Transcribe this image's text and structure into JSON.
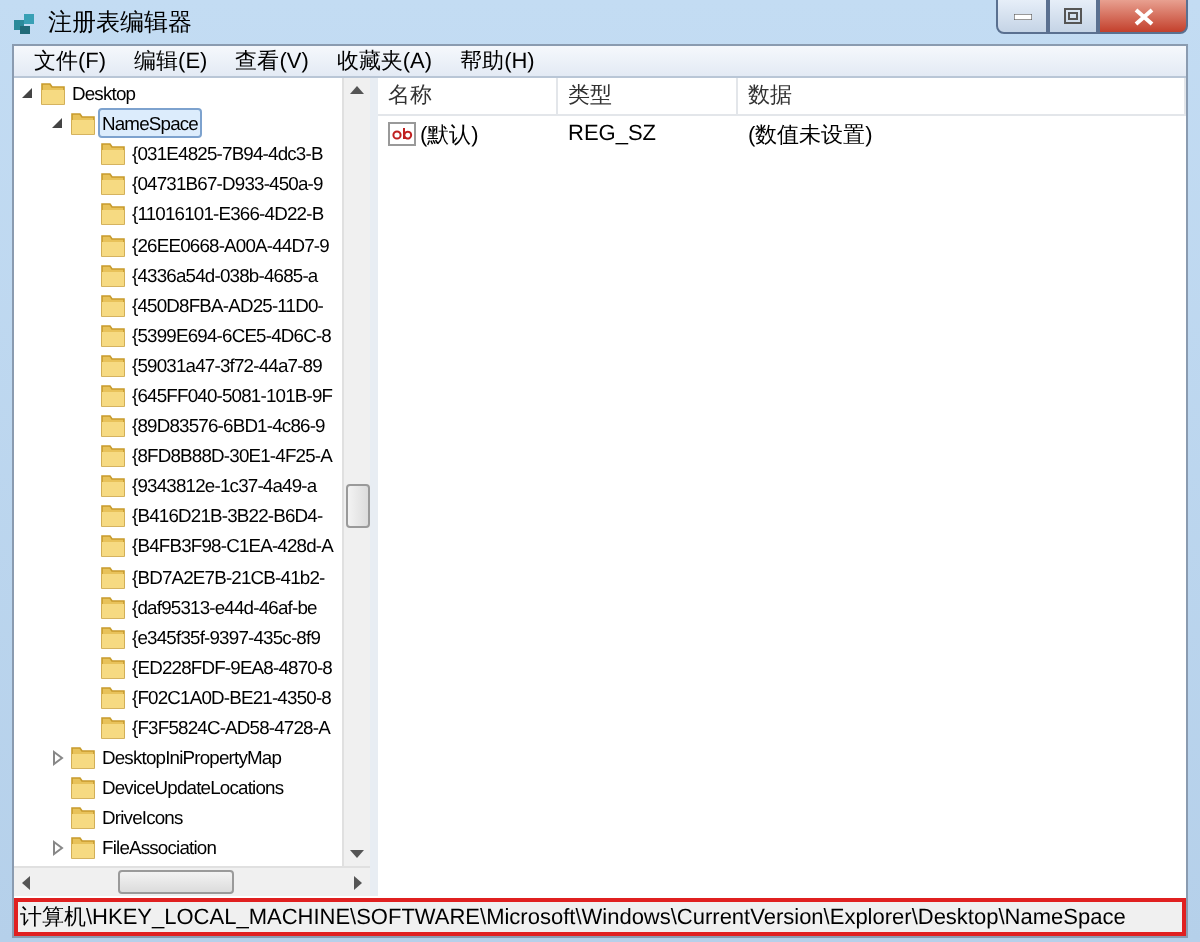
{
  "window": {
    "title": "注册表编辑器"
  },
  "menu": [
    "文件(F)",
    "编辑(E)",
    "查看(V)",
    "收藏夹(A)",
    "帮助(H)"
  ],
  "tree": [
    {
      "label": "Desktop",
      "expanded": true,
      "selected": false,
      "children": [
        {
          "label": "NameSpace",
          "expanded": true,
          "selected": true,
          "children": [
            {
              "label": "{031E4825-7B94-4dc3-B",
              "selected": false
            },
            {
              "label": "{04731B67-D933-450a-9",
              "selected": false
            },
            {
              "label": "{11016101-E366-4D22-B",
              "selected": false
            },
            {
              "label": "{26EE0668-A00A-44D7-9",
              "selected": false
            },
            {
              "label": "{4336a54d-038b-4685-a",
              "selected": false
            },
            {
              "label": "{450D8FBA-AD25-11D0-",
              "selected": false
            },
            {
              "label": "{5399E694-6CE5-4D6C-8",
              "selected": false
            },
            {
              "label": "{59031a47-3f72-44a7-89",
              "selected": false
            },
            {
              "label": "{645FF040-5081-101B-9F",
              "selected": false
            },
            {
              "label": "{89D83576-6BD1-4c86-9",
              "selected": false
            },
            {
              "label": "{8FD8B88D-30E1-4F25-A",
              "selected": false
            },
            {
              "label": "{9343812e-1c37-4a49-a",
              "selected": false
            },
            {
              "label": "{B416D21B-3B22-B6D4-",
              "selected": false
            },
            {
              "label": "{B4FB3F98-C1EA-428d-A",
              "selected": false
            },
            {
              "label": "{BD7A2E7B-21CB-41b2-",
              "selected": false
            },
            {
              "label": "{daf95313-e44d-46af-be",
              "selected": false
            },
            {
              "label": "{e345f35f-9397-435c-8f9",
              "selected": false
            },
            {
              "label": "{ED228FDF-9EA8-4870-8",
              "selected": false
            },
            {
              "label": "{F02C1A0D-BE21-4350-8",
              "selected": false
            },
            {
              "label": "{F3F5824C-AD58-4728-A",
              "selected": false
            }
          ]
        },
        {
          "label": "DesktopIniPropertyMap",
          "expanded": false,
          "selected": false
        },
        {
          "label": "DeviceUpdateLocations",
          "selected": false
        },
        {
          "label": "DriveIcons",
          "selected": false
        },
        {
          "label": "FileAssociation",
          "expanded": false,
          "selected": false
        }
      ]
    }
  ],
  "values": {
    "columns": [
      "名称",
      "类型",
      "数据"
    ],
    "rows": [
      {
        "name": "(默认)",
        "type": "REG_SZ",
        "data": "(数值未设置)"
      }
    ]
  },
  "status_bar": {
    "path": "计算机\\HKEY_LOCAL_MACHINE\\SOFTWARE\\Microsoft\\Windows\\CurrentVersion\\Explorer\\Desktop\\NameSpace",
    "highlighted": true
  }
}
